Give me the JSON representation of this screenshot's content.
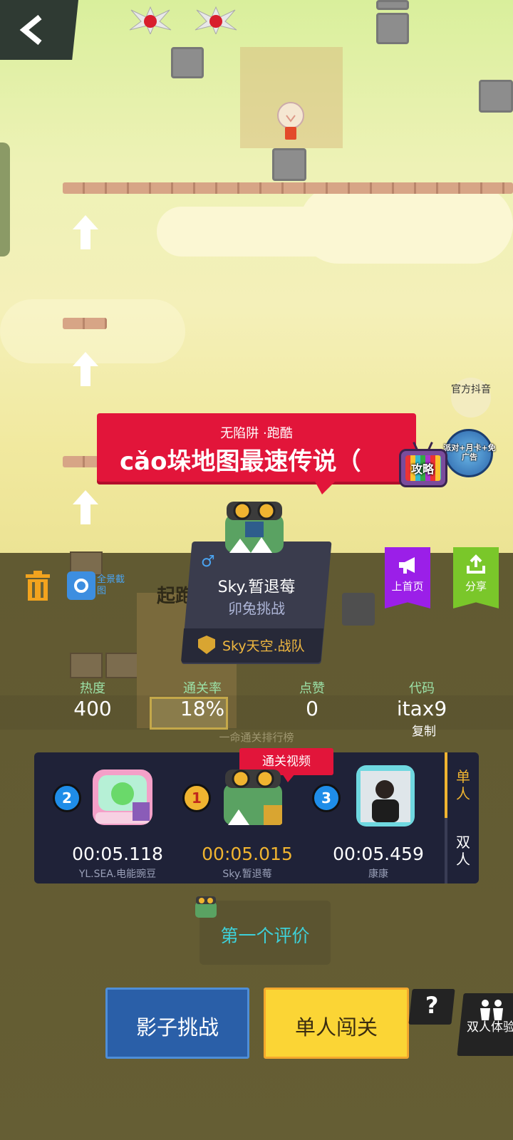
{
  "navigation": {
    "back_icon": "chevron-left-icon"
  },
  "level": {
    "subtitle": "无陷阱 ·跑酷",
    "title": "cǎo垛地图最速传说（"
  },
  "side_actions": {
    "strategy_label": "攻略",
    "official_label": "官方抖音",
    "promo_label": "派对+月卡+免广告"
  },
  "tools": {
    "panorama_label": "全景截图",
    "start_label": "起跑"
  },
  "author": {
    "gender_icon": "male-icon",
    "name": "Sky.暂退莓",
    "title": "卯兔挑战",
    "team": "Sky天空.战队"
  },
  "promo_buttons": {
    "homepage_label": "上首页",
    "share_label": "分享",
    "homepage_color": "#9b1fe8",
    "share_color": "#7ac72a"
  },
  "stats": [
    {
      "label": "热度",
      "value": "400"
    },
    {
      "label": "通关率",
      "value": "18%"
    },
    {
      "label": "点赞",
      "value": "0"
    },
    {
      "label": "代码",
      "value": "itax9"
    }
  ],
  "copy_label": "复制",
  "leaderboard": {
    "caption": "一命通关排行榜",
    "video_tag": "通关视频",
    "modes": [
      "单人",
      "双人"
    ],
    "active_mode": "单人",
    "entries": [
      {
        "rank": "2",
        "time": "00:05.118",
        "name": "YL.SEA.电能豌豆"
      },
      {
        "rank": "1",
        "time": "00:05.015",
        "name": "Sky.暂退莓"
      },
      {
        "rank": "3",
        "time": "00:05.459",
        "name": "康康"
      }
    ]
  },
  "review": {
    "label": "第一个评价"
  },
  "buttons": {
    "shadow_challenge": "影子挑战",
    "single_play": "单人闯关",
    "help": "?",
    "duo_experience": "双人体验"
  },
  "colors": {
    "banner_red": "#e2153a",
    "rank_gold": "#f0b430",
    "stat_label_green": "#9be0a6",
    "review_cyan": "#3ed0d8"
  }
}
